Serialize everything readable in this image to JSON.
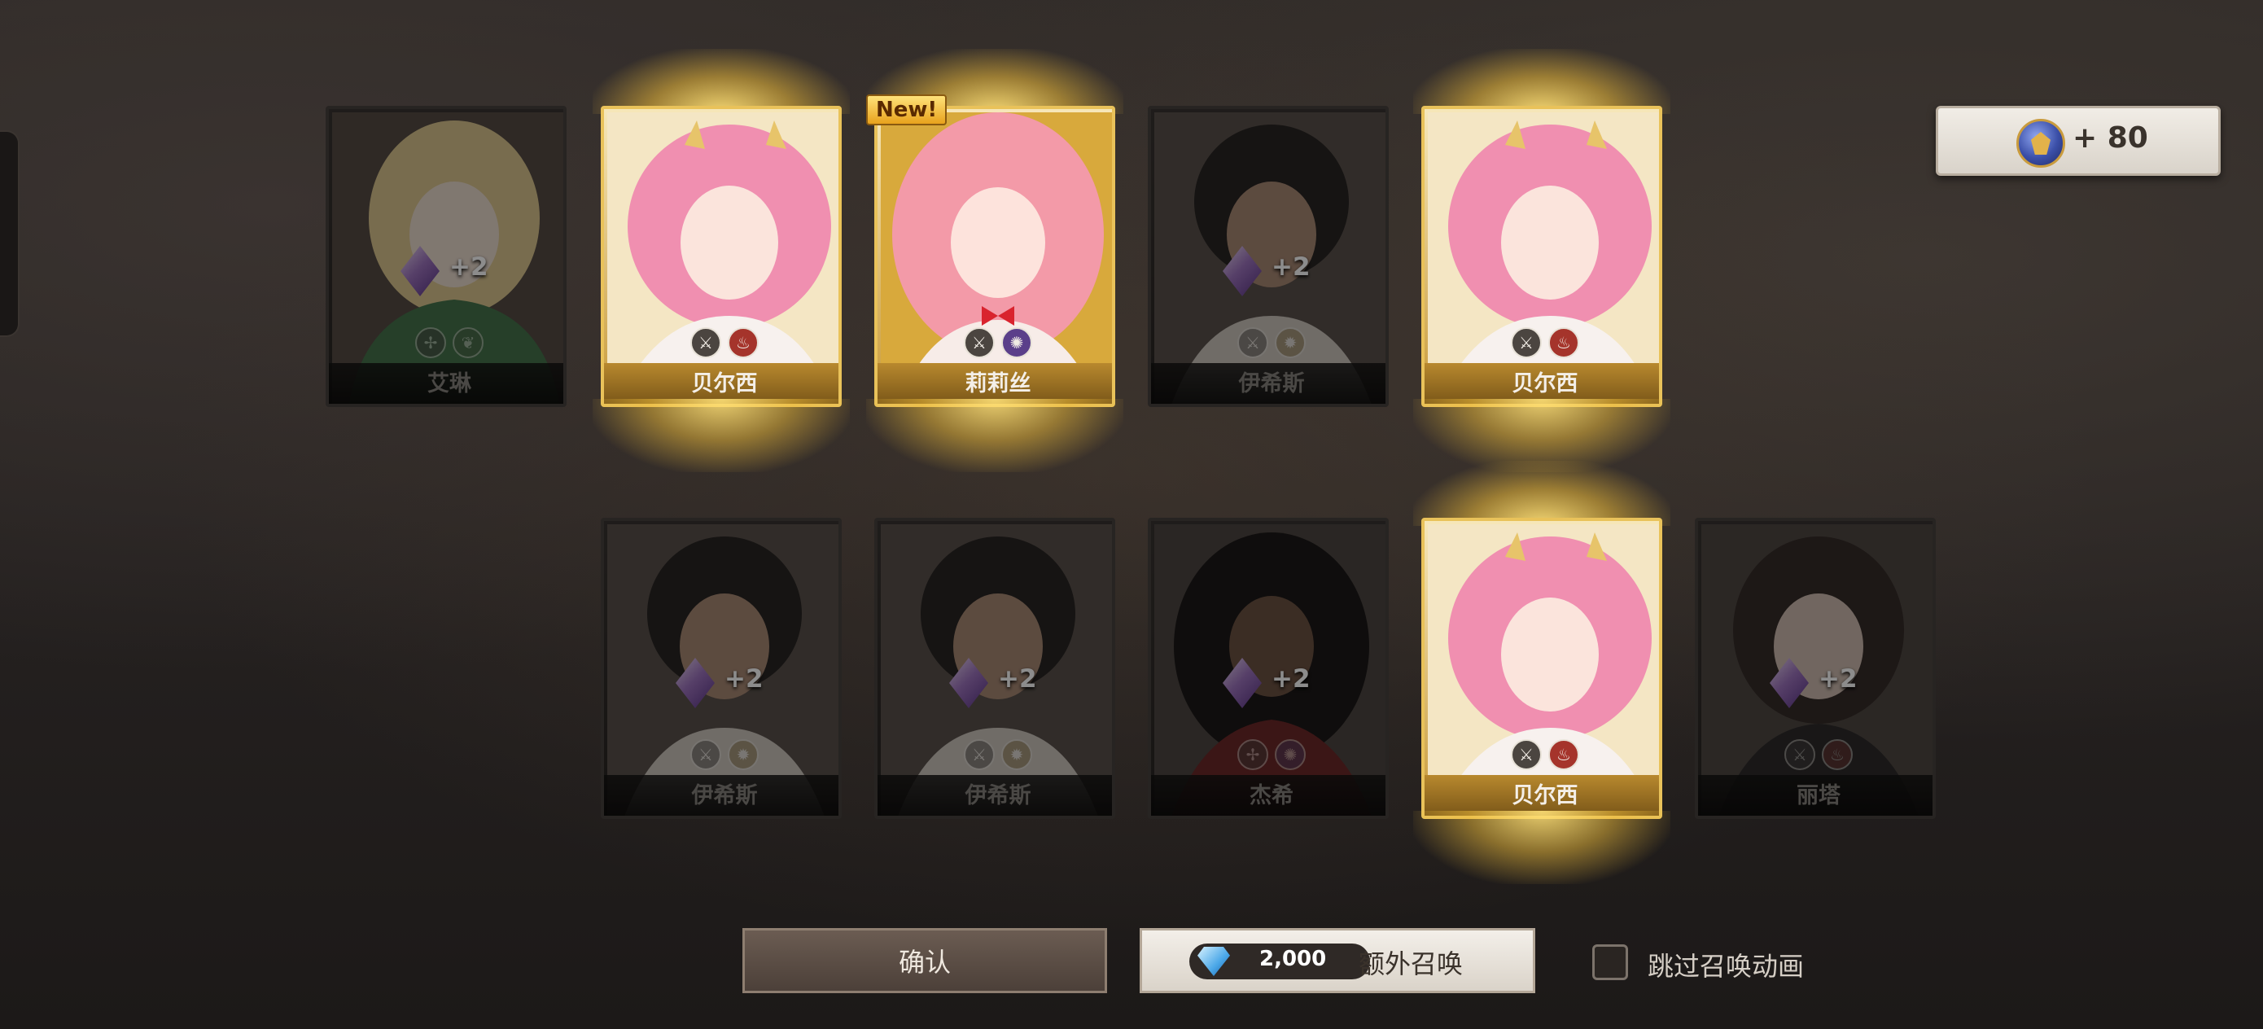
{
  "reward": {
    "icon": "summon-medal-icon",
    "amount": "+ 80"
  },
  "cards_row1": [
    {
      "name": "艾琳",
      "state": "dim",
      "gem": "+2",
      "elements": [
        "wind-icon",
        "leaf-icon"
      ]
    },
    {
      "name": "贝尔西",
      "state": "gold",
      "elements": [
        "sword-icon",
        "fire-icon"
      ]
    },
    {
      "name": "莉莉丝",
      "state": "gold",
      "new": "New!",
      "elements": [
        "sword-icon",
        "dark-icon"
      ]
    },
    {
      "name": "伊希斯",
      "state": "dim",
      "gem": "+2",
      "elements": [
        "sword-icon",
        "light-icon"
      ]
    },
    {
      "name": "贝尔西",
      "state": "gold",
      "elements": [
        "sword-icon",
        "fire-icon"
      ]
    }
  ],
  "cards_row2": [
    {
      "name": "伊希斯",
      "state": "dim",
      "gem": "+2",
      "elements": [
        "sword-icon",
        "light-icon"
      ]
    },
    {
      "name": "伊希斯",
      "state": "dim",
      "gem": "+2",
      "elements": [
        "sword-icon",
        "light-icon"
      ]
    },
    {
      "name": "杰希",
      "state": "dim",
      "gem": "+2",
      "elements": [
        "wind-icon",
        "dark-icon"
      ]
    },
    {
      "name": "贝尔西",
      "state": "gold",
      "elements": [
        "sword-icon",
        "fire-icon"
      ]
    },
    {
      "name": "丽塔",
      "state": "dim",
      "gem": "+2",
      "elements": [
        "sword-icon",
        "fire-icon"
      ]
    }
  ],
  "buttons": {
    "confirm": "确认",
    "extra_cost": "2,000",
    "extra_label": "额外召唤",
    "skip_label": "跳过召唤动画"
  },
  "colors": {
    "gold": "#e9c25a",
    "accent_purple": "#b06ae6"
  }
}
